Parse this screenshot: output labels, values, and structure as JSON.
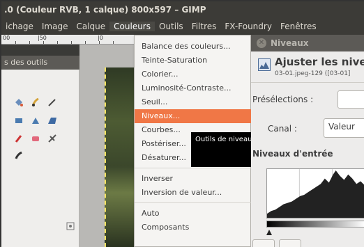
{
  "window": {
    "title": ".0 (Couleur RVB, 1 calque) 800x597 – GIMP"
  },
  "menubar": [
    {
      "label": "ichage"
    },
    {
      "label": "Image"
    },
    {
      "label": "Calque"
    },
    {
      "label": "Couleurs",
      "active": true
    },
    {
      "label": "Outils"
    },
    {
      "label": "Filtres"
    },
    {
      "label": "FX-Foundry"
    },
    {
      "label": "Fenêtres"
    }
  ],
  "ruler": {
    "labels": [
      "00",
      "|50",
      "|0"
    ]
  },
  "toolbox": {
    "title": "s des outils"
  },
  "colors_menu": {
    "items": [
      "Balance des couleurs...",
      "Teinte-Saturation",
      "Colorier...",
      "Luminosité-Contraste...",
      "Seuil...",
      "Niveaux...",
      "Courbes...",
      "Postériser...",
      "Désaturer...",
      "Inverser",
      "Inversion de valeur...",
      "Auto",
      "Composants"
    ],
    "selected": "Niveaux..."
  },
  "tooltip": {
    "text": "Outils de niveaux"
  },
  "dialog": {
    "window_title": "Niveaux",
    "heading": "Ajuster les niveaux",
    "subtitle": "03-01.jpeg-129 ([03-01]",
    "presets_label": "Présélections :",
    "channel_label": "Canal :",
    "channel_value": "Valeur",
    "input_levels_label": "Niveaux d'entrée"
  },
  "colors": {
    "menu_highlight": "#f07746",
    "titlebar": "#3c3b37",
    "dialog_bg": "#edeceb"
  }
}
